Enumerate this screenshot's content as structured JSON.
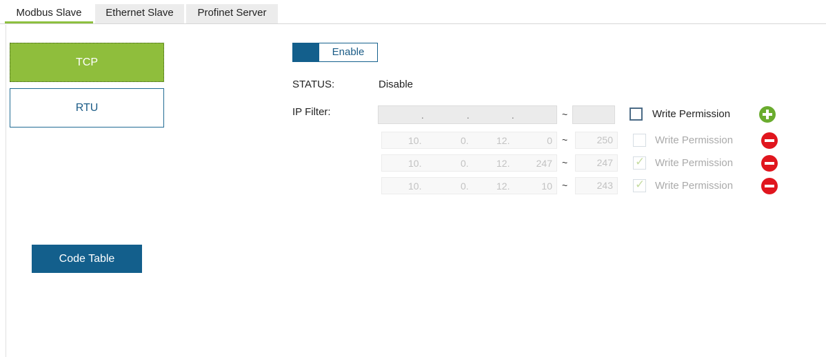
{
  "tabs": [
    {
      "label": "Modbus Slave",
      "active": true
    },
    {
      "label": "Ethernet Slave",
      "active": false
    },
    {
      "label": "Profinet Server",
      "active": false
    }
  ],
  "modes": {
    "tcp": "TCP",
    "rtu": "RTU",
    "selected": "TCP"
  },
  "code_table_label": "Code Table",
  "enable": {
    "label": "Enable",
    "on": true
  },
  "status": {
    "label": "STATUS:",
    "value": "Disable"
  },
  "ip_filter": {
    "label": "IP Filter:",
    "new_entry": {
      "ip": ". . .",
      "end": "",
      "tilde": "~",
      "write_permission": false,
      "write_label": "Write Permission"
    },
    "rows": [
      {
        "oct1": "10.",
        "oct2": "0.",
        "oct3": "12.",
        "oct4": "0",
        "tilde": "~",
        "end": "250",
        "write_permission": false,
        "write_label": "Write Permission"
      },
      {
        "oct1": "10.",
        "oct2": "0.",
        "oct3": "12.",
        "oct4": "247",
        "tilde": "~",
        "end": "247",
        "write_permission": true,
        "write_label": "Write Permission"
      },
      {
        "oct1": "10.",
        "oct2": "0.",
        "oct3": "12.",
        "oct4": "10",
        "tilde": "~",
        "end": "243",
        "write_permission": true,
        "write_label": "Write Permission"
      }
    ]
  },
  "colors": {
    "accent_green": "#8fbe3c",
    "accent_blue": "#135f8c",
    "add": "#6aac2e",
    "remove": "#e0161e"
  },
  "icons": {
    "add": "plus-circle-icon",
    "remove": "minus-circle-icon",
    "check": "checkmark-icon"
  }
}
